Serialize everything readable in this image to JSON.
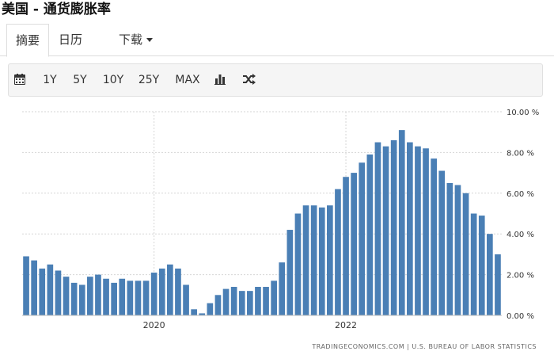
{
  "header": {
    "title": "美国 - 通货膨胀率"
  },
  "tabs": [
    {
      "label": "摘要",
      "active": true
    },
    {
      "label": "日历",
      "active": false
    },
    {
      "label": "下载",
      "active": false
    }
  ],
  "toolbar": {
    "calendar_icon": "calendar-icon",
    "ranges": [
      "1Y",
      "5Y",
      "10Y",
      "25Y",
      "MAX"
    ],
    "bar_chart_icon": "bar-chart-icon",
    "shuffle_icon": "shuffle-icon"
  },
  "colors": {
    "bar": "#4a7fb5",
    "grid": "#d6d6d6",
    "tab_border": "#dddddd",
    "toolbar_bg": "#f5f5f5"
  },
  "source": "TRADINGECONOMICS.COM  |  U.S. BUREAU OF LABOR STATISTICS",
  "chart_data": {
    "type": "bar",
    "title": "",
    "xlabel": "",
    "ylabel": "",
    "ylim": [
      0,
      10
    ],
    "y_ticks": [
      0,
      2,
      4,
      6,
      8,
      10
    ],
    "y_tick_labels": [
      "0.00 %",
      "2.00 %",
      "4.00 %",
      "6.00 %",
      "8.00 %",
      "10.00 %"
    ],
    "y_axis_side": "right",
    "x_tick_labels": [
      {
        "label": "2020",
        "index": 16
      },
      {
        "label": "2022",
        "index": 40
      }
    ],
    "grid": true,
    "unit": "%",
    "values": [
      2.9,
      2.7,
      2.3,
      2.5,
      2.2,
      1.9,
      1.6,
      1.5,
      1.9,
      2.0,
      1.8,
      1.6,
      1.8,
      1.7,
      1.7,
      1.7,
      2.1,
      2.3,
      2.5,
      2.3,
      1.5,
      0.3,
      0.1,
      0.6,
      1.0,
      1.3,
      1.4,
      1.2,
      1.2,
      1.4,
      1.4,
      1.7,
      2.6,
      4.2,
      5.0,
      5.4,
      5.4,
      5.3,
      5.4,
      6.2,
      6.8,
      7.0,
      7.5,
      7.9,
      8.5,
      8.3,
      8.6,
      9.1,
      8.5,
      8.3,
      8.2,
      7.7,
      7.1,
      6.5,
      6.4,
      6.0,
      5.0,
      4.9,
      4.0,
      3.0
    ]
  }
}
